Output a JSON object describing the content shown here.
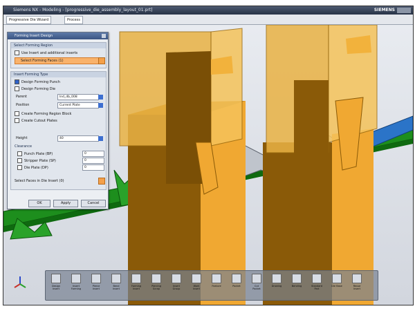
{
  "window": {
    "title": "Siemens NX - Modeling - [progressive_die_assembly_layout_01.prt]",
    "brand": "SIEMENS"
  },
  "toolstrip": {
    "tabs": [
      "Progressive Die Wizard",
      "Process"
    ]
  },
  "dialog": {
    "title": "Forming Insert Design",
    "group_select": {
      "header": "Select Forming Region",
      "checkbox_label": "Use Insert and additional inserts",
      "selected_label": "Select Forming Faces (1)"
    },
    "group_insert": {
      "header": "Insert Forming Type",
      "option1": "Design Forming Punch",
      "option2": "Design Forming Die",
      "parent_label": "Parent",
      "parent_value": "lnd_db_008",
      "position_label": "Position",
      "position_value": "Current Plate",
      "checkbox1": "Create Forming Region Block",
      "checkbox2": "Create Cutout Plates",
      "height_label": "Height",
      "height_value": "40",
      "clearance_header": "Clearance",
      "clearance_items": [
        "Punch Plate (BP)",
        "Stripper Plate (SP)",
        "Die Plate (DP)"
      ],
      "clearance_values": [
        "0",
        "0",
        "0"
      ],
      "select_faces": "Select Faces in Die Insert (0)"
    },
    "buttons": {
      "ok": "OK",
      "apply": "Apply",
      "cancel": "Cancel"
    }
  },
  "dock": {
    "items": [
      "Design Insert",
      "Insert Forming",
      "Pierce Insert",
      "Bend Insert",
      "Forming Insert",
      "Piercing Scrap",
      "Insert Group",
      "Work Insert",
      "Feature",
      "Pocket",
      "Cut Pocket",
      "Drawing",
      "Bending",
      "Standard Part",
      "Die Base",
      "Reuse Insert"
    ]
  },
  "colors": {
    "accent": "#f0a832",
    "strip": "#1f9a1f",
    "dialog_bg": "#eceff3"
  }
}
